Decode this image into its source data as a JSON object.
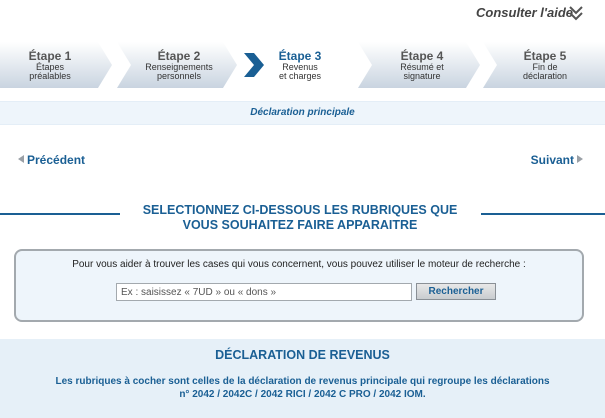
{
  "help": {
    "label": "Consulter l'aide"
  },
  "steps": [
    {
      "title": "Étape 1",
      "sub1": "Étapes",
      "sub2": "préalables",
      "active": false
    },
    {
      "title": "Étape 2",
      "sub1": "Renseignements",
      "sub2": "personnels",
      "active": false
    },
    {
      "title": "Étape 3",
      "sub1": "Revenus",
      "sub2": "et charges",
      "active": true
    },
    {
      "title": "Étape 4",
      "sub1": "Résumé et",
      "sub2": "signature",
      "active": false
    },
    {
      "title": "Étape 5",
      "sub1": "Fin de",
      "sub2": "déclaration",
      "active": false
    }
  ],
  "sub_title": "Déclaration principale",
  "nav": {
    "prev": "Précédent",
    "next": "Suivant"
  },
  "heading": {
    "line1": "SELECTIONNEZ CI-DESSOUS LES RUBRIQUES QUE",
    "line2": "VOUS SOUHAITEZ FAIRE APPARAITRE"
  },
  "search": {
    "hint": "Pour vous aider à trouver les cases qui vous concernent, vous pouvez utiliser le moteur de recherche :",
    "placeholder": "Ex : saisissez « 7UD » ou « dons »",
    "button": "Rechercher"
  },
  "declaration": {
    "title": "DÉCLARATION DE REVENUS",
    "line1": "Les rubriques à cocher sont celles de la déclaration de revenus principale qui regroupe les déclarations",
    "line2": "n° 2042 / 2042C / 2042 RICI / 2042 C PRO / 2042 IOM."
  },
  "colors": {
    "accent": "#1a5f94",
    "panel": "#eef5fb",
    "active_arrow": "#1a5f94"
  }
}
